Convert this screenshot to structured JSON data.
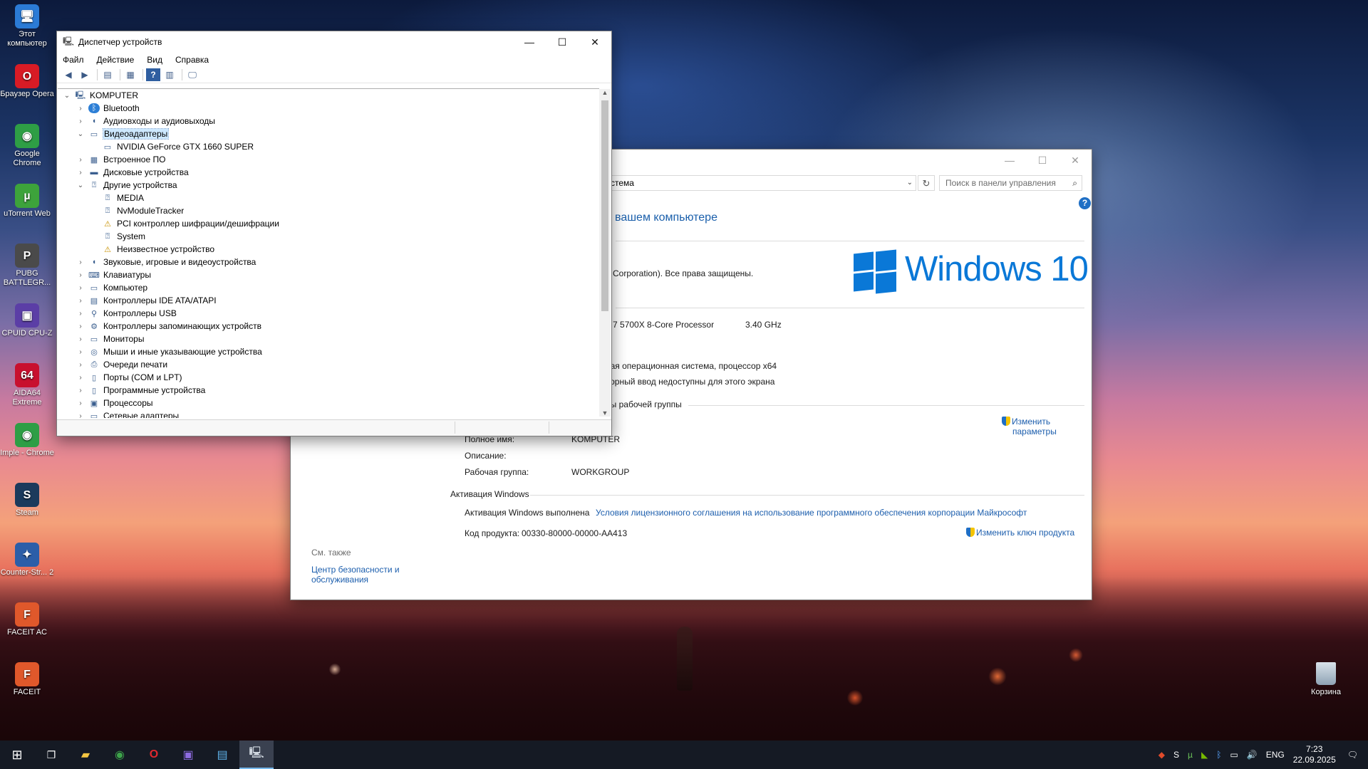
{
  "desktop": {
    "icons": [
      {
        "label": "Этот компьютер",
        "name": "this-pc-icon",
        "glyph": "🖥",
        "color": "#2b7bd6"
      },
      {
        "label": "Браузер Opera",
        "name": "opera-icon",
        "glyph": "O",
        "color": "#d81b25"
      },
      {
        "label": "Google Chrome",
        "name": "chrome-icon",
        "glyph": "◉",
        "color": "#2e9e45"
      },
      {
        "label": "uTorrent Web",
        "name": "utorrent-icon",
        "glyph": "µ",
        "color": "#3da33b"
      },
      {
        "label": "PUBG BATTLEGR...",
        "name": "pubg-icon",
        "glyph": "P",
        "color": "#4a4a4a"
      },
      {
        "label": "CPUID CPU-Z",
        "name": "cpuz-icon",
        "glyph": "▣",
        "color": "#5b3ea6"
      },
      {
        "label": "AIDA64 Extreme",
        "name": "aida64-icon",
        "glyph": "64",
        "color": "#c8102e"
      },
      {
        "label": "Imple - Chrome",
        "name": "chrome-app-icon",
        "glyph": "◉",
        "color": "#2e9e45"
      },
      {
        "label": "Steam",
        "name": "steam-icon",
        "glyph": "S",
        "color": "#1b3a5c"
      },
      {
        "label": "Counter-Str... 2",
        "name": "cs2-icon",
        "glyph": "✦",
        "color": "#2c5ea8"
      },
      {
        "label": "FACEIT AC",
        "name": "faceit-ac-icon",
        "glyph": "F",
        "color": "#e0582b"
      },
      {
        "label": "FACEIT",
        "name": "faceit-icon",
        "glyph": "F",
        "color": "#e0582b"
      }
    ],
    "trash_label": "Корзина"
  },
  "system_window": {
    "address_text": "стема",
    "search_placeholder": "Поиск в панели управления",
    "heading": "вашем компьютере",
    "copyright": "ft Corporation). Все права защищены.",
    "brand_text": "Windows 10",
    "processor": "n 7 5700X 8-Core Processor",
    "processor_speed": "3.40 GHz",
    "os_type": "ная операционная система, процессор x64",
    "pen_touch": "сорный ввод недоступны для этого экрана",
    "workgroup_section": "ры рабочей группы",
    "computer_name_value": "R",
    "full_name_label": "Полное имя:",
    "full_name_value": "KOMPUTER",
    "description_label": "Описание:",
    "workgroup_label": "Рабочая группа:",
    "workgroup_value": "WORKGROUP",
    "change_params_line1": "Изменить",
    "change_params_line2": "параметры",
    "activation_section": "Активация Windows",
    "activation_status": "Активация Windows выполнена",
    "license_link": "Условия лицензионного соглашения на использование программного обеспечения корпорации Майкрософт",
    "product_key_label": "Код продукта:",
    "product_key_value": "00330-80000-00000-AA413",
    "change_key_link": "Изменить ключ продукта",
    "see_also": "См. также",
    "security_link_line1": "Центр безопасности и",
    "security_link_line2": "обслуживания"
  },
  "device_manager": {
    "title": "Диспетчер устройств",
    "menu": [
      "Файл",
      "Действие",
      "Вид",
      "Справка"
    ],
    "tree": [
      {
        "label": "KOMPUTER",
        "level": 0,
        "expanded": true,
        "icon": "computer-icon",
        "glyph": "🖳"
      },
      {
        "label": "Bluetooth",
        "level": 1,
        "expanded": false,
        "icon": "bluetooth-icon",
        "glyph": "ᛒ"
      },
      {
        "label": "Аудиовходы и аудиовыходы",
        "level": 1,
        "expanded": false,
        "icon": "speaker-icon",
        "glyph": "◖"
      },
      {
        "label": "Видеоадаптеры",
        "level": 1,
        "expanded": true,
        "selected": true,
        "icon": "display-adapter-icon",
        "glyph": "▭"
      },
      {
        "label": "NVIDIA GeForce GTX 1660 SUPER",
        "level": 2,
        "icon": "display-adapter-icon",
        "glyph": "▭"
      },
      {
        "label": "Встроенное ПО",
        "level": 1,
        "expanded": false,
        "icon": "firmware-icon",
        "glyph": "▦"
      },
      {
        "label": "Дисковые устройства",
        "level": 1,
        "expanded": false,
        "icon": "disk-icon",
        "glyph": "▬"
      },
      {
        "label": "Другие устройства",
        "level": 1,
        "expanded": true,
        "icon": "unknown-device-icon",
        "glyph": "⍰"
      },
      {
        "label": "MEDIA",
        "level": 2,
        "icon": "unknown-device-icon",
        "glyph": "⍰"
      },
      {
        "label": "NvModuleTracker",
        "level": 2,
        "icon": "unknown-device-icon",
        "glyph": "⍰"
      },
      {
        "label": "PCI контроллер шифрации/дешифрации",
        "level": 2,
        "icon": "warning-device-icon",
        "glyph": "⚠"
      },
      {
        "label": "System",
        "level": 2,
        "icon": "unknown-device-icon",
        "glyph": "⍰"
      },
      {
        "label": "Неизвестное устройство",
        "level": 2,
        "icon": "warning-device-icon",
        "glyph": "⚠"
      },
      {
        "label": "Звуковые, игровые и видеоустройства",
        "level": 1,
        "expanded": false,
        "icon": "sound-icon",
        "glyph": "◖"
      },
      {
        "label": "Клавиатуры",
        "level": 1,
        "expanded": false,
        "icon": "keyboard-icon",
        "glyph": "⌨"
      },
      {
        "label": "Компьютер",
        "level": 1,
        "expanded": false,
        "icon": "monitor-icon",
        "glyph": "▭"
      },
      {
        "label": "Контроллеры IDE ATA/ATAPI",
        "level": 1,
        "expanded": false,
        "icon": "ide-icon",
        "glyph": "▤"
      },
      {
        "label": "Контроллеры USB",
        "level": 1,
        "expanded": false,
        "icon": "usb-icon",
        "glyph": "⚲"
      },
      {
        "label": "Контроллеры запоминающих устройств",
        "level": 1,
        "expanded": false,
        "icon": "storage-icon",
        "glyph": "⚙"
      },
      {
        "label": "Мониторы",
        "level": 1,
        "expanded": false,
        "icon": "monitor-icon",
        "glyph": "▭"
      },
      {
        "label": "Мыши и иные указывающие устройства",
        "level": 1,
        "expanded": false,
        "icon": "mouse-icon",
        "glyph": "◎"
      },
      {
        "label": "Очереди печати",
        "level": 1,
        "expanded": false,
        "icon": "printer-icon",
        "glyph": "⎙"
      },
      {
        "label": "Порты (COM и LPT)",
        "level": 1,
        "expanded": false,
        "icon": "port-icon",
        "glyph": "▯"
      },
      {
        "label": "Программные устройства",
        "level": 1,
        "expanded": false,
        "icon": "software-device-icon",
        "glyph": "▯"
      },
      {
        "label": "Процессоры",
        "level": 1,
        "expanded": false,
        "icon": "cpu-icon",
        "glyph": "▣"
      },
      {
        "label": "Сетевые адаптеры",
        "level": 1,
        "expanded": false,
        "icon": "network-icon",
        "glyph": "▭"
      }
    ]
  },
  "taskbar": {
    "language": "ENG",
    "time": "7:23",
    "date": "22.09.2025"
  },
  "colors": {
    "accent": "#0a78d7",
    "link": "#1c5ead",
    "taskbar": "#151a24",
    "selection": "#cde8ff"
  }
}
